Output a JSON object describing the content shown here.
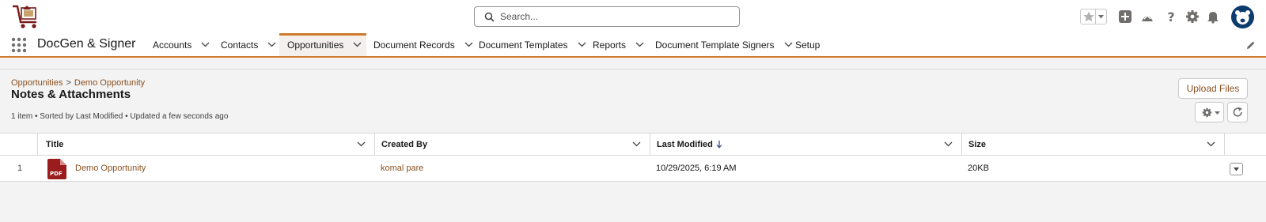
{
  "header": {
    "search_placeholder": "Search...",
    "brand_color": "#d07a2c",
    "icons": [
      "shopping-cart-logo",
      "star-icon",
      "plus-icon",
      "trailhead-icon",
      "help-icon",
      "gear-icon",
      "bell-icon",
      "avatar"
    ]
  },
  "nav": {
    "app_name": "DocGen & Signer",
    "items": [
      {
        "label": "Accounts"
      },
      {
        "label": "Contacts"
      },
      {
        "label": "Opportunities",
        "active": true
      },
      {
        "label": "Document Records"
      },
      {
        "label": "Document Templates"
      },
      {
        "label": "Reports"
      },
      {
        "label": "Document Template Signers"
      },
      {
        "label": "Setup"
      }
    ]
  },
  "page": {
    "breadcrumb": [
      "Opportunities",
      "Demo Opportunity"
    ],
    "breadcrumb_sep": ">",
    "title": "Notes & Attachments",
    "list_info": "1 item • Sorted by Last Modified • Updated a few seconds ago",
    "upload_label": "Upload Files"
  },
  "table": {
    "columns": [
      "Title",
      "Created By",
      "Last Modified",
      "Size"
    ],
    "sorted_column": "Last Modified",
    "rows": [
      {
        "num": "1",
        "file_type": "PDF",
        "title": "Demo Opportunity",
        "created_by": "komal pare",
        "last_modified": "10/29/2025, 6:19 AM",
        "size": "20KB"
      }
    ]
  }
}
